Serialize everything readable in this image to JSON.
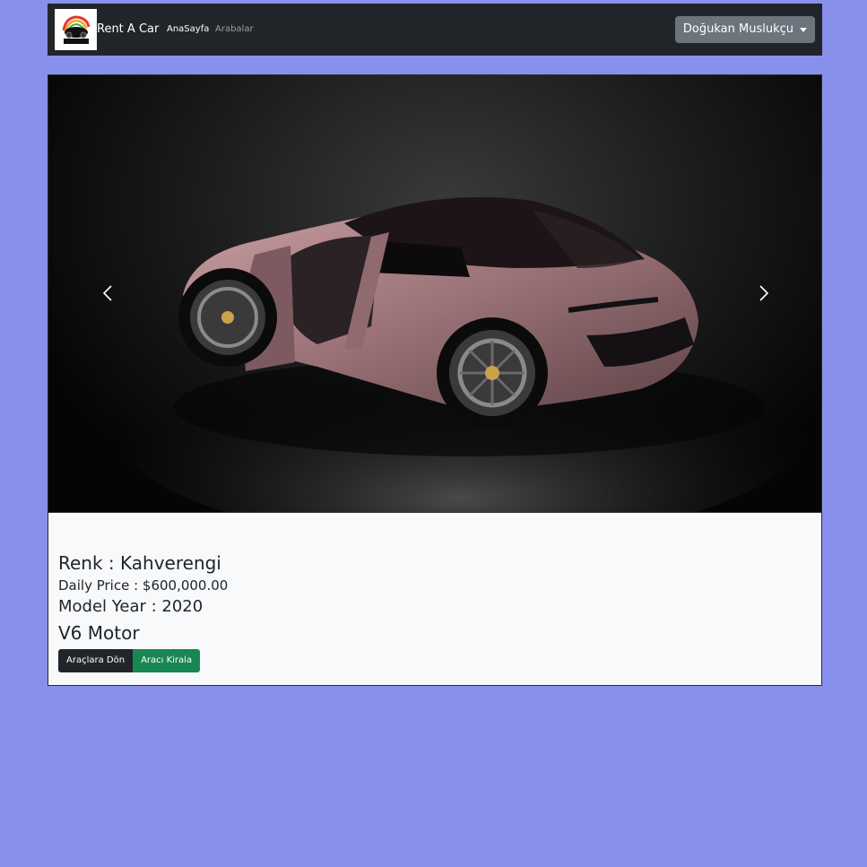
{
  "navbar": {
    "brand_name": "Rent A Car",
    "logo_text": "RACING",
    "links": [
      "AnaSayfa",
      "Arabalar"
    ],
    "user_menu_label": "Doğukan Muslukçu"
  },
  "carousel": {
    "prev_icon": "chevron-left-icon",
    "next_icon": "chevron-right-icon"
  },
  "car_details": {
    "color": "Renk : Kahverengi",
    "daily_price": "Daily Price : $600,000.00",
    "model_year": "Model Year : 2020",
    "description": "V6 Motor"
  },
  "buttons": {
    "back": "Araçlara Dön",
    "rent": "Aracı Kirala"
  },
  "colors": {
    "background": "#8890ec",
    "navbar": "#212529",
    "user_button": "#6c757d",
    "rent_button": "#198754",
    "back_button": "#212529"
  }
}
